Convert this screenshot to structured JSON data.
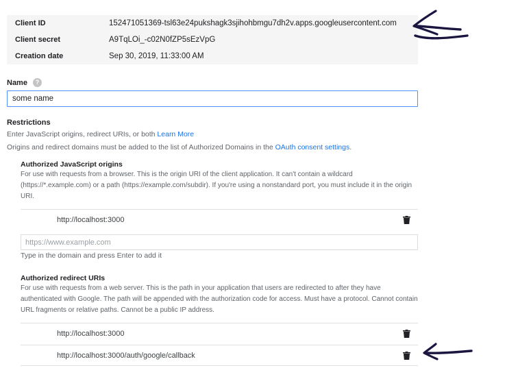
{
  "client_info": [
    {
      "label": "Client ID",
      "value": "152471051369-tsl63e24pukshagk3sjihohbmgu7dh2v.apps.googleusercontent.com"
    },
    {
      "label": "Client secret",
      "value": "A9TqLOi_-c02N0fZP5sEzVpG"
    },
    {
      "label": "Creation date",
      "value": "Sep 30, 2019, 11:33:00 AM"
    }
  ],
  "name": {
    "label": "Name",
    "help_icon": "?",
    "value": "some name"
  },
  "restrictions": {
    "title": "Restrictions",
    "desc": "Enter JavaScript origins, redirect URIs, or both ",
    "learn_more": "Learn More",
    "origins_note": "Origins and redirect domains must be added to the list of Authorized Domains in the ",
    "consent_link": "OAuth consent settings",
    "origins_note_end": "."
  },
  "js_origins": {
    "title": "Authorized JavaScript origins",
    "desc": "For use with requests from a browser. This is the origin URI of the client application. It can't contain a wildcard (https://*.example.com) or a path (https://example.com/subdir). If you're using a nonstandard port, you must include it in the origin URI.",
    "items": [
      "http://localhost:3000"
    ],
    "input_placeholder": "https://www.example.com",
    "input_hint": "Type in the domain and press Enter to add it"
  },
  "redirect_uris": {
    "title": "Authorized redirect URIs",
    "desc": "For use with requests from a web server. This is the path in your application that users are redirected to after they have authenticated with Google. The path will be appended with the authorization code for access. Must have a protocol. Cannot contain URL fragments or relative paths. Cannot be a public IP address.",
    "items": [
      "http://localhost:3000",
      "http://localhost:3000/auth/google/callback"
    ]
  },
  "icons": {
    "delete": "trash-icon",
    "help": "help-icon",
    "annotation": "hand-drawn-arrow"
  },
  "colors": {
    "link": "#1a73e8",
    "input_focus": "#4d90fe",
    "annotation": "#1a1640"
  }
}
